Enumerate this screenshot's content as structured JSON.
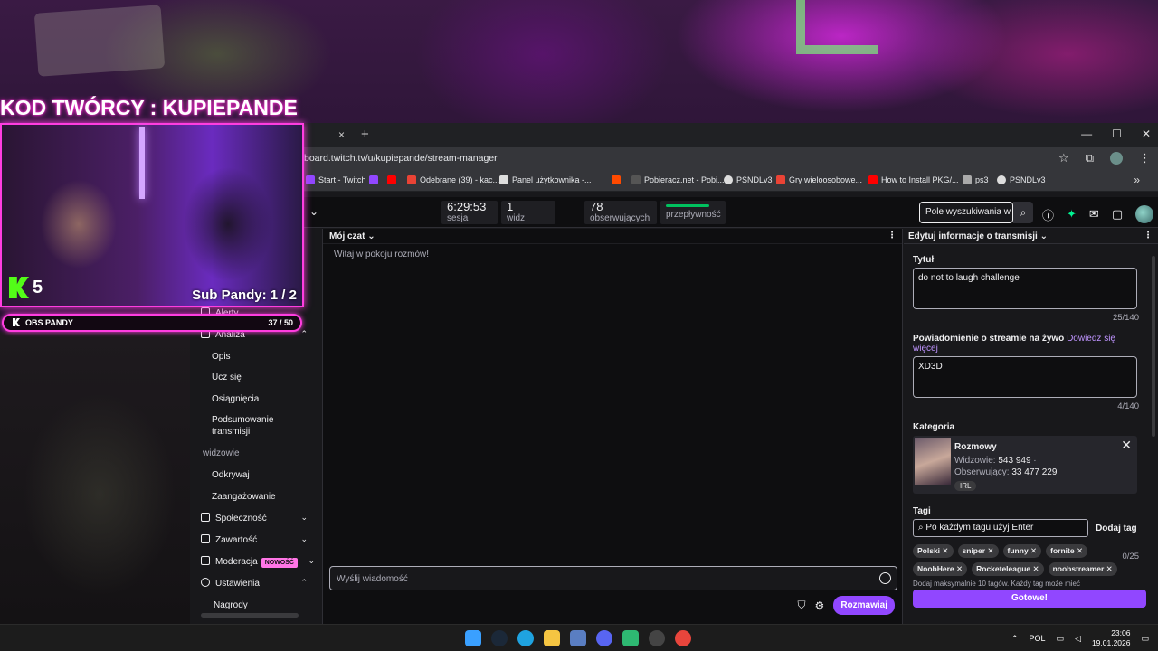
{
  "overlay": {
    "title": "KOD TWÓRCY : KUPIEPANDE",
    "kick_count": "5",
    "subs_label": "Sub Pandy: 1 / 2",
    "obs_label": "OBS PANDY",
    "obs_goal": "37 / 50"
  },
  "browser": {
    "tab_close": "×",
    "tab_new": "+",
    "url": "board.twitch.tv/u/kupiepande/stream-manager",
    "window_controls": [
      "—",
      "☐",
      "✕"
    ],
    "bookmarks": [
      {
        "label": "Start - Twitch",
        "color": "#9147ff"
      },
      {
        "label": "",
        "color": "#9147ff"
      },
      {
        "label": "",
        "color": "#ff0000"
      },
      {
        "label": "Odebrane (39) - kac...",
        "color": "#ea4335"
      },
      {
        "label": "Panel użytkownika -...",
        "color": "#dddddd"
      },
      {
        "label": "",
        "color": "#ff4a00"
      },
      {
        "label": "Pobieracz.net - Pobi...",
        "color": "#555555"
      },
      {
        "label": "PSNDLv3",
        "color": "#dddddd"
      },
      {
        "label": "Gry wieloosobowe...",
        "color": "#ea4335"
      },
      {
        "label": "How to Install PKG/...",
        "color": "#ff0000"
      },
      {
        "label": "ps3",
        "color": "#aaaaaa"
      },
      {
        "label": "PSNDLv3",
        "color": "#dddddd"
      }
    ]
  },
  "stats": {
    "session_time": "6:29:53",
    "session_label": "sesja",
    "viewers": "1",
    "viewers_label": "widz",
    "followers": "78",
    "followers_label": "obserwujących",
    "bandwidth_label": "przepływność",
    "search_placeholder": "Pole wyszukiwania w"
  },
  "sidebar": {
    "items": [
      {
        "label": "Alerty"
      },
      {
        "label": "Analiza"
      }
    ],
    "analiza_sub": [
      "Opis",
      "Ucz się",
      "Osiągnięcia",
      "Podsumowanie transmisji"
    ],
    "section": "widzowie",
    "viewers_sub": [
      "Odkrywaj",
      "Zaangażowanie"
    ],
    "bottom": [
      {
        "label": "Społeczność"
      },
      {
        "label": "Zawartość"
      },
      {
        "label": "Moderacja",
        "badge": "NOWOŚĆ"
      },
      {
        "label": "Ustawienia"
      },
      {
        "label": "Nagrody"
      }
    ]
  },
  "chat": {
    "header": "Mój czat",
    "welcome": "Witaj w pokoju rozmów!",
    "input_placeholder": "Wyślij wiadomość",
    "send_label": "Rozmawiaj"
  },
  "panel": {
    "header": "Edytuj informacje o transmisji",
    "title_label": "Tytuł",
    "title_value": "do not to laugh challenge",
    "title_count": "25/140",
    "notif_label": "Powiadomienie o streamie na żywo",
    "notif_link": "Dowiedz się więcej",
    "notif_value": "XD3D",
    "notif_count": "4/140",
    "category_label": "Kategoria",
    "category": {
      "name": "Rozmowy",
      "viewers_label": "Widzowie:",
      "viewers": "543 949",
      "followers_label": "Obserwujący:",
      "followers": "33 477 229",
      "tag": "IRL"
    },
    "tags_label": "Tagi",
    "tags_placeholder": "Po każdym tagu użyj Enter",
    "add_tag": "Dodaj tag",
    "tags": [
      "Polski ✕",
      "sniper ✕",
      "funny ✕",
      "fornite ✕",
      "NoobHere ✕",
      "Rocketeleague ✕",
      "noobstreamer ✕"
    ],
    "tags_count": "0/25",
    "tags_hint": "Dodaj maksymalnie 10 tagów. Każdy tag może mieć",
    "done": "Gotowe!"
  },
  "taskbar": {
    "lang": "POL",
    "time": "23:06",
    "date": "19.01.2026",
    "apps": [
      {
        "name": "windows-start",
        "color": "#3aa0ff"
      },
      {
        "name": "steam",
        "color": "#1b2838"
      },
      {
        "name": "edge",
        "color": "#1fa3e0"
      },
      {
        "name": "explorer",
        "color": "#f5c542"
      },
      {
        "name": "app-tiles",
        "color": "#5a7ec2"
      },
      {
        "name": "discord",
        "color": "#5865f2"
      },
      {
        "name": "app-green",
        "color": "#2eb872"
      },
      {
        "name": "obs",
        "color": "#444444"
      },
      {
        "name": "chrome",
        "color": "#e8453c"
      }
    ]
  }
}
